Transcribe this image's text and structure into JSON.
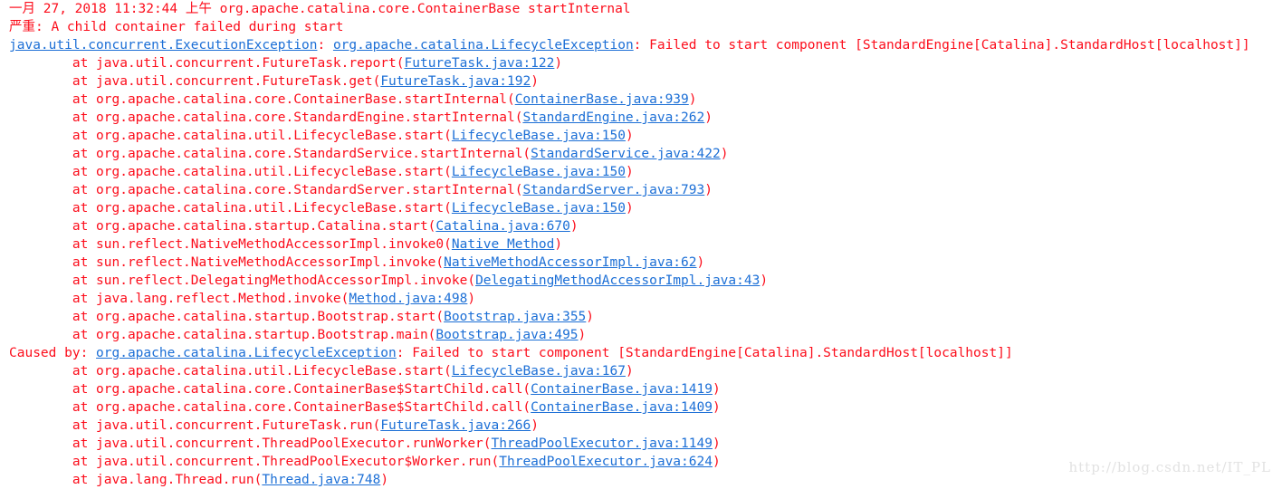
{
  "console": {
    "name": "java-stack-trace-console",
    "background_color": "#ffffff",
    "text_color": "#fc0d1b",
    "link_color": "#1c6fd6",
    "watermark": "http://blog.csdn.net/IT_PL",
    "lines": [
      {
        "id": "line-timestamp-logger",
        "segments": [
          {
            "type": "plain",
            "text": "一月 27, 2018 11:32:44 上午 org.apache.catalina.core.ContainerBase startInternal"
          }
        ]
      },
      {
        "id": "line-severity-message",
        "segments": [
          {
            "type": "plain",
            "text": "严重: A child container failed during start"
          }
        ]
      },
      {
        "id": "line-exception-header",
        "segments": [
          {
            "type": "link",
            "text": "java.util.concurrent.ExecutionException"
          },
          {
            "type": "plain",
            "text": ": "
          },
          {
            "type": "link",
            "text": "org.apache.catalina.LifecycleException"
          },
          {
            "type": "plain",
            "text": ": Failed to start component [StandardEngine[Catalina].StandardHost[localhost]]"
          }
        ]
      },
      {
        "id": "line-frame-1",
        "segments": [
          {
            "type": "plain",
            "text": "        at java.util.concurrent.FutureTask.report("
          },
          {
            "type": "link",
            "text": "FutureTask.java:122"
          },
          {
            "type": "plain",
            "text": ")"
          }
        ]
      },
      {
        "id": "line-frame-2",
        "segments": [
          {
            "type": "plain",
            "text": "        at java.util.concurrent.FutureTask.get("
          },
          {
            "type": "link",
            "text": "FutureTask.java:192"
          },
          {
            "type": "plain",
            "text": ")"
          }
        ]
      },
      {
        "id": "line-frame-3",
        "segments": [
          {
            "type": "plain",
            "text": "        at org.apache.catalina.core.ContainerBase.startInternal("
          },
          {
            "type": "link",
            "text": "ContainerBase.java:939"
          },
          {
            "type": "plain",
            "text": ")"
          }
        ]
      },
      {
        "id": "line-frame-4",
        "segments": [
          {
            "type": "plain",
            "text": "        at org.apache.catalina.core.StandardEngine.startInternal("
          },
          {
            "type": "link",
            "text": "StandardEngine.java:262"
          },
          {
            "type": "plain",
            "text": ")"
          }
        ]
      },
      {
        "id": "line-frame-5",
        "segments": [
          {
            "type": "plain",
            "text": "        at org.apache.catalina.util.LifecycleBase.start("
          },
          {
            "type": "link",
            "text": "LifecycleBase.java:150"
          },
          {
            "type": "plain",
            "text": ")"
          }
        ]
      },
      {
        "id": "line-frame-6",
        "segments": [
          {
            "type": "plain",
            "text": "        at org.apache.catalina.core.StandardService.startInternal("
          },
          {
            "type": "link",
            "text": "StandardService.java:422"
          },
          {
            "type": "plain",
            "text": ")"
          }
        ]
      },
      {
        "id": "line-frame-7",
        "segments": [
          {
            "type": "plain",
            "text": "        at org.apache.catalina.util.LifecycleBase.start("
          },
          {
            "type": "link",
            "text": "LifecycleBase.java:150"
          },
          {
            "type": "plain",
            "text": ")"
          }
        ]
      },
      {
        "id": "line-frame-8",
        "segments": [
          {
            "type": "plain",
            "text": "        at org.apache.catalina.core.StandardServer.startInternal("
          },
          {
            "type": "link",
            "text": "StandardServer.java:793"
          },
          {
            "type": "plain",
            "text": ")"
          }
        ]
      },
      {
        "id": "line-frame-9",
        "segments": [
          {
            "type": "plain",
            "text": "        at org.apache.catalina.util.LifecycleBase.start("
          },
          {
            "type": "link",
            "text": "LifecycleBase.java:150"
          },
          {
            "type": "plain",
            "text": ")"
          }
        ]
      },
      {
        "id": "line-frame-10",
        "segments": [
          {
            "type": "plain",
            "text": "        at org.apache.catalina.startup.Catalina.start("
          },
          {
            "type": "link",
            "text": "Catalina.java:670"
          },
          {
            "type": "plain",
            "text": ")"
          }
        ]
      },
      {
        "id": "line-frame-11",
        "segments": [
          {
            "type": "plain",
            "text": "        at sun.reflect.NativeMethodAccessorImpl.invoke0("
          },
          {
            "type": "link",
            "text": "Native Method"
          },
          {
            "type": "plain",
            "text": ")"
          }
        ]
      },
      {
        "id": "line-frame-12",
        "segments": [
          {
            "type": "plain",
            "text": "        at sun.reflect.NativeMethodAccessorImpl.invoke("
          },
          {
            "type": "link",
            "text": "NativeMethodAccessorImpl.java:62"
          },
          {
            "type": "plain",
            "text": ")"
          }
        ]
      },
      {
        "id": "line-frame-13",
        "segments": [
          {
            "type": "plain",
            "text": "        at sun.reflect.DelegatingMethodAccessorImpl.invoke("
          },
          {
            "type": "link",
            "text": "DelegatingMethodAccessorImpl.java:43"
          },
          {
            "type": "plain",
            "text": ")"
          }
        ]
      },
      {
        "id": "line-frame-14",
        "segments": [
          {
            "type": "plain",
            "text": "        at java.lang.reflect.Method.invoke("
          },
          {
            "type": "link",
            "text": "Method.java:498"
          },
          {
            "type": "plain",
            "text": ")"
          }
        ]
      },
      {
        "id": "line-frame-15",
        "segments": [
          {
            "type": "plain",
            "text": "        at org.apache.catalina.startup.Bootstrap.start("
          },
          {
            "type": "link",
            "text": "Bootstrap.java:355"
          },
          {
            "type": "plain",
            "text": ")"
          }
        ]
      },
      {
        "id": "line-frame-16",
        "segments": [
          {
            "type": "plain",
            "text": "        at org.apache.catalina.startup.Bootstrap.main("
          },
          {
            "type": "link",
            "text": "Bootstrap.java:495"
          },
          {
            "type": "plain",
            "text": ")"
          }
        ]
      },
      {
        "id": "line-caused-by",
        "segments": [
          {
            "type": "plain",
            "text": "Caused by: "
          },
          {
            "type": "link",
            "text": "org.apache.catalina.LifecycleException"
          },
          {
            "type": "plain",
            "text": ": Failed to start component [StandardEngine[Catalina].StandardHost[localhost]]"
          }
        ]
      },
      {
        "id": "line-cause-frame-1",
        "segments": [
          {
            "type": "plain",
            "text": "        at org.apache.catalina.util.LifecycleBase.start("
          },
          {
            "type": "link",
            "text": "LifecycleBase.java:167"
          },
          {
            "type": "plain",
            "text": ")"
          }
        ]
      },
      {
        "id": "line-cause-frame-2",
        "segments": [
          {
            "type": "plain",
            "text": "        at org.apache.catalina.core.ContainerBase$StartChild.call("
          },
          {
            "type": "link",
            "text": "ContainerBase.java:1419"
          },
          {
            "type": "plain",
            "text": ")"
          }
        ]
      },
      {
        "id": "line-cause-frame-3",
        "segments": [
          {
            "type": "plain",
            "text": "        at org.apache.catalina.core.ContainerBase$StartChild.call("
          },
          {
            "type": "link",
            "text": "ContainerBase.java:1409"
          },
          {
            "type": "plain",
            "text": ")"
          }
        ]
      },
      {
        "id": "line-cause-frame-4",
        "segments": [
          {
            "type": "plain",
            "text": "        at java.util.concurrent.FutureTask.run("
          },
          {
            "type": "link",
            "text": "FutureTask.java:266"
          },
          {
            "type": "plain",
            "text": ")"
          }
        ]
      },
      {
        "id": "line-cause-frame-5",
        "segments": [
          {
            "type": "plain",
            "text": "        at java.util.concurrent.ThreadPoolExecutor.runWorker("
          },
          {
            "type": "link",
            "text": "ThreadPoolExecutor.java:1149"
          },
          {
            "type": "plain",
            "text": ")"
          }
        ]
      },
      {
        "id": "line-cause-frame-6",
        "segments": [
          {
            "type": "plain",
            "text": "        at java.util.concurrent.ThreadPoolExecutor$Worker.run("
          },
          {
            "type": "link",
            "text": "ThreadPoolExecutor.java:624"
          },
          {
            "type": "plain",
            "text": ")"
          }
        ]
      },
      {
        "id": "line-cause-frame-7",
        "segments": [
          {
            "type": "plain",
            "text": "        at java.lang.Thread.run("
          },
          {
            "type": "link",
            "text": "Thread.java:748"
          },
          {
            "type": "plain",
            "text": ")"
          }
        ]
      }
    ]
  }
}
